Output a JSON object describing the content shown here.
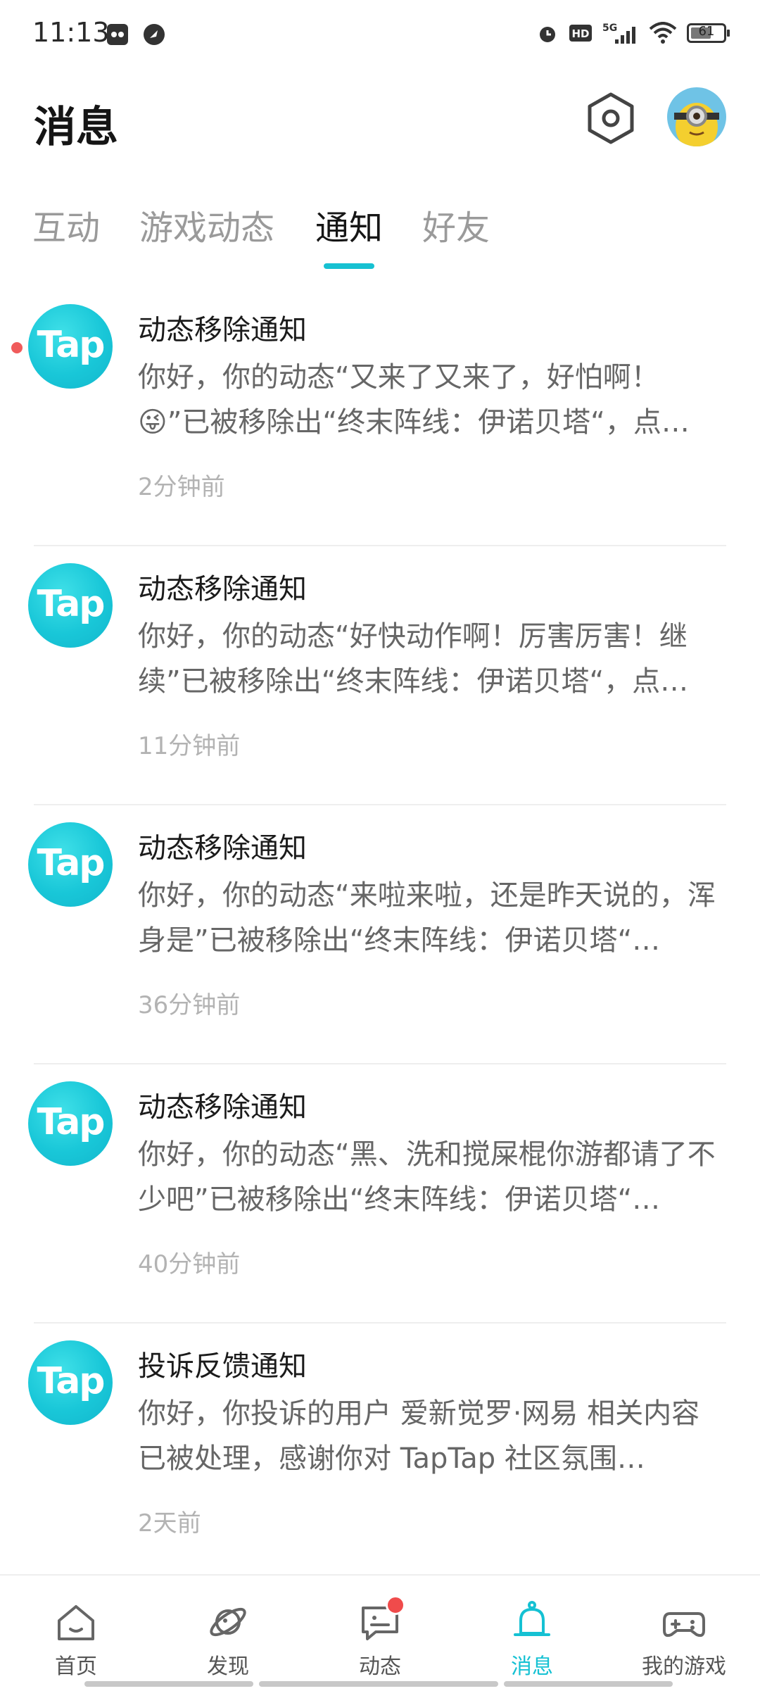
{
  "status_bar": {
    "time": "11:13",
    "network": "5G",
    "hd_label": "HD",
    "battery": "61"
  },
  "header": {
    "title": "消息"
  },
  "tabs": [
    {
      "label": "互动",
      "active": false
    },
    {
      "label": "游戏动态",
      "active": false
    },
    {
      "label": "通知",
      "active": true
    },
    {
      "label": "好友",
      "active": false
    }
  ],
  "notifications": [
    {
      "logo_text": "Tap",
      "title": "动态移除通知",
      "body": "你好，你的动态“又来了又来了，好怕啊！😜”已被移除出“终末阵线：伊诺贝塔“，点…",
      "time": "2分钟前",
      "unread": true
    },
    {
      "logo_text": "Tap",
      "title": "动态移除通知",
      "body": "你好，你的动态“好快动作啊！厉害厉害！继续”已被移除出“终末阵线：伊诺贝塔“，点…",
      "time": "11分钟前",
      "unread": false
    },
    {
      "logo_text": "Tap",
      "title": "动态移除通知",
      "body": "你好，你的动态“来啦来啦，还是昨天说的，浑身是”已被移除出“终末阵线：伊诺贝塔“…",
      "time": "36分钟前",
      "unread": false
    },
    {
      "logo_text": "Tap",
      "title": "动态移除通知",
      "body": "你好，你的动态“黑、洗和搅屎棍你游都请了不少吧”已被移除出“终末阵线：伊诺贝塔“…",
      "time": "40分钟前",
      "unread": false
    },
    {
      "logo_text": "Tap",
      "title": "投诉反馈通知",
      "body": "你好，你投诉的用户 爱新觉罗·网易 相关内容已被处理，感谢你对 TapTap 社区氛围…",
      "time": "2天前",
      "unread": false
    }
  ],
  "bottom_nav": [
    {
      "label": "首页",
      "icon": "home-icon",
      "active": false
    },
    {
      "label": "发现",
      "icon": "planet-icon",
      "active": false
    },
    {
      "label": "动态",
      "icon": "chat-icon",
      "active": false,
      "badge": true
    },
    {
      "label": "消息",
      "icon": "bell-icon",
      "active": true
    },
    {
      "label": "我的游戏",
      "icon": "gamepad-icon",
      "active": false
    }
  ],
  "colors": {
    "accent": "#17c1d2",
    "badge": "#f04b4b",
    "unread_dot": "#f05b5b"
  }
}
